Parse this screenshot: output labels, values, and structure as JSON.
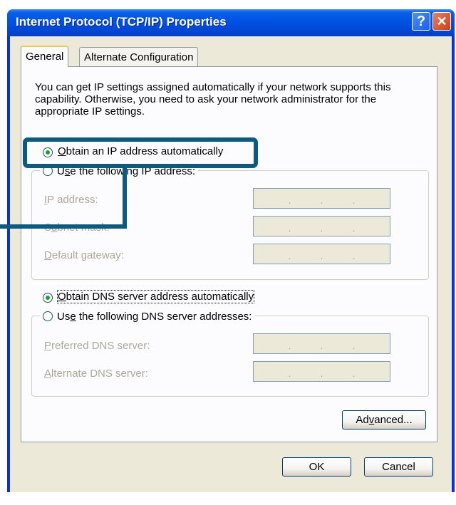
{
  "window": {
    "title": "Internet Protocol (TCP/IP) Properties",
    "help_glyph": "?",
    "close_glyph": "✕"
  },
  "tabs": [
    {
      "label": "General",
      "selected": true
    },
    {
      "label": "Alternate Configuration",
      "selected": false
    }
  ],
  "intro_text": "You can get IP settings assigned automatically if your network supports this capability. Otherwise, you need to ask your network administrator for the appropriate IP settings.",
  "ip_section": {
    "auto_option": {
      "prefix": "",
      "accel": "O",
      "rest": "btain an IP address automatically",
      "selected": true
    },
    "manual_option": {
      "prefix": "U",
      "accel": "s",
      "rest": "e the following IP address:",
      "selected": false
    },
    "fields": [
      {
        "accel": "I",
        "rest": "P address:",
        "prefix": ""
      },
      {
        "prefix": "S",
        "accel": "u",
        "rest": "bnet mask:"
      },
      {
        "prefix": "",
        "accel": "D",
        "rest": "efault gateway:"
      }
    ]
  },
  "dns_section": {
    "auto_option": {
      "prefix": "",
      "accel": "O",
      "rest": "btain DNS server address automatically",
      "selected": true
    },
    "manual_option": {
      "prefix": "Us",
      "accel": "e",
      "rest": " the following DNS server addresses:",
      "selected": false
    },
    "fields": [
      {
        "prefix": "",
        "accel": "P",
        "rest": "referred DNS server:"
      },
      {
        "prefix": "",
        "accel": "A",
        "rest": "lternate DNS server:"
      }
    ]
  },
  "ip_dot": ".",
  "buttons": {
    "advanced": {
      "prefix": "Ad",
      "accel": "v",
      "rest": "anced..."
    },
    "ok": "OK",
    "cancel": "Cancel"
  },
  "colors": {
    "title_blue": "#0054e3",
    "dialog_bg": "#ece9d8",
    "callout": "#0d5a80"
  }
}
